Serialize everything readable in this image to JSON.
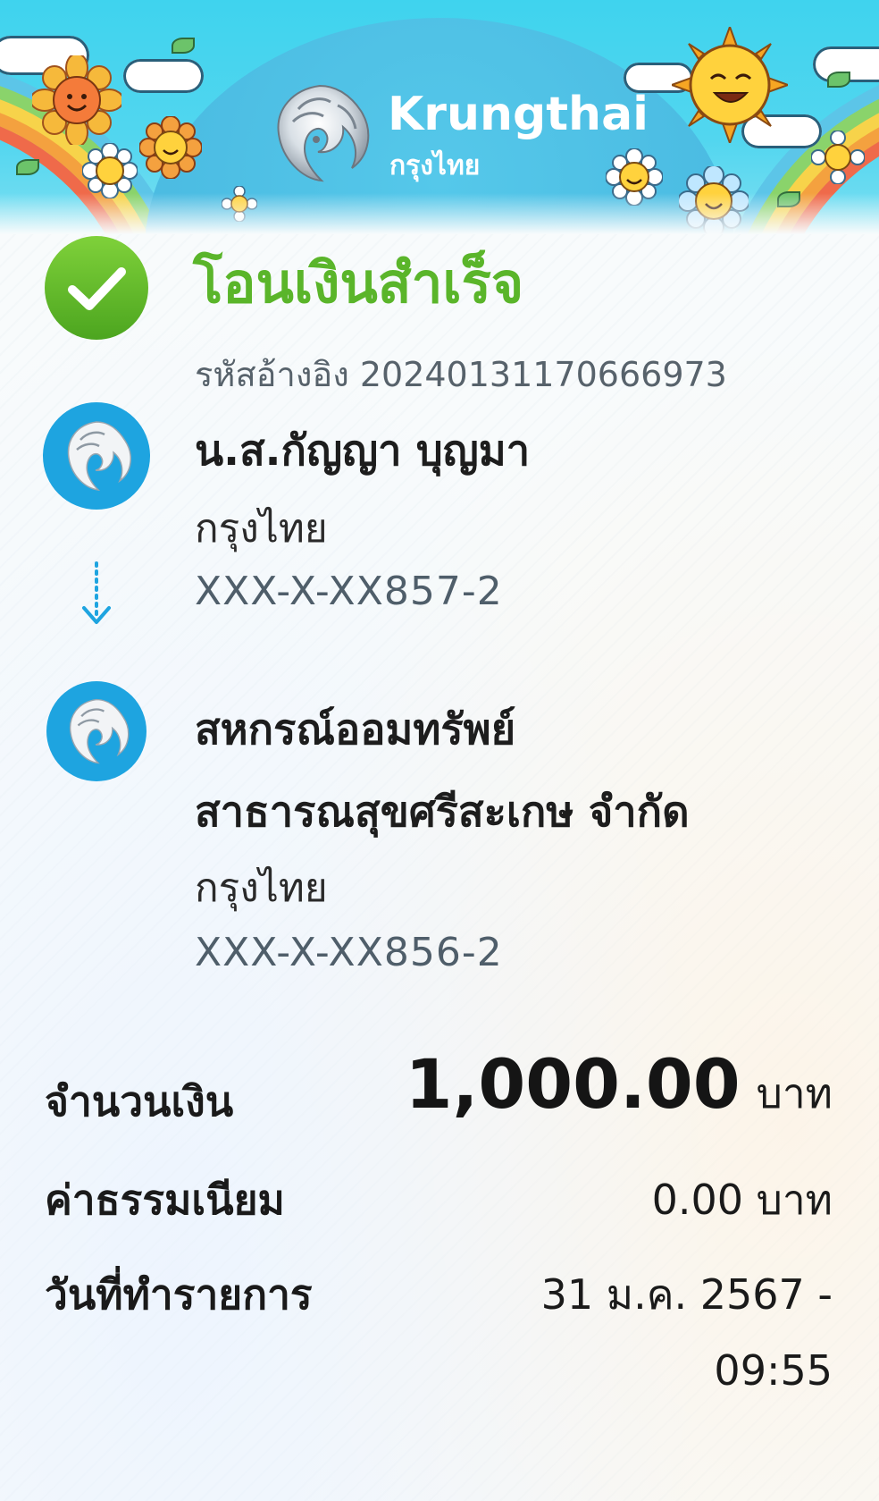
{
  "header": {
    "brand_en": "Krungthai",
    "brand_th": "กรุงไทย"
  },
  "status": {
    "title": "โอนเงินสำเร็จ",
    "ref_label": "รหัสอ้างอิง",
    "ref_number": "20240131170666973"
  },
  "sender": {
    "name": "น.ส.กัญญา บุญมา",
    "bank": "กรุงไทย",
    "account": "XXX-X-XX857-2"
  },
  "receiver": {
    "name_line1": "สหกรณ์ออมทรัพย์",
    "name_line2": "สาธารณสุขศรีสะเกษ จำกัด",
    "bank": "กรุงไทย",
    "account": "XXX-X-XX856-2"
  },
  "summary": {
    "amount_label": "จำนวนเงิน",
    "amount_value": "1,000.00",
    "amount_unit": "บาท",
    "fee_label": "ค่าธรรมเนียม",
    "fee_value": "0.00 บาท",
    "date_label": "วันที่ทำรายการ",
    "date_value": "31 ม.ค. 2567 -",
    "time_value": "09:55"
  },
  "colors": {
    "success_green": "#5ab52a",
    "brand_blue": "#1ea4e0",
    "header_cyan": "#3fd3ee"
  },
  "icons": {
    "success": "check-circle-icon",
    "bank_logo": "krungthai-phoenix-icon",
    "arrow": "dotted-arrow-down-icon"
  }
}
